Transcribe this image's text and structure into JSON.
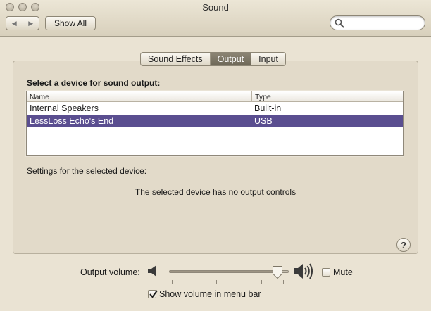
{
  "window": {
    "title": "Sound"
  },
  "toolbar": {
    "show_all_label": "Show All",
    "search_placeholder": ""
  },
  "tabs": [
    {
      "label": "Sound Effects",
      "selected": false
    },
    {
      "label": "Output",
      "selected": true
    },
    {
      "label": "Input",
      "selected": false
    }
  ],
  "output": {
    "section_label": "Select a device for sound output:",
    "columns": {
      "name": "Name",
      "type": "Type"
    },
    "devices": [
      {
        "name": "Internal Speakers",
        "type": "Built-in",
        "selected": false
      },
      {
        "name": "LessLoss Echo's End",
        "type": "USB",
        "selected": true
      }
    ],
    "settings_label": "Settings for the selected device:",
    "no_controls_text": "The selected device has no output controls"
  },
  "volume": {
    "label": "Output volume:",
    "level_percent": 95,
    "mute_label": "Mute",
    "mute_checked": false,
    "show_in_menu_bar_label": "Show volume in menu bar",
    "show_in_menu_bar_checked": true
  },
  "icons": {
    "search": "search-icon",
    "speaker_low": "speaker-low-icon",
    "speaker_high": "speaker-high-icon",
    "help": "help-icon"
  },
  "colors": {
    "selection": "#5a4e90",
    "background": "#eae3d3"
  }
}
